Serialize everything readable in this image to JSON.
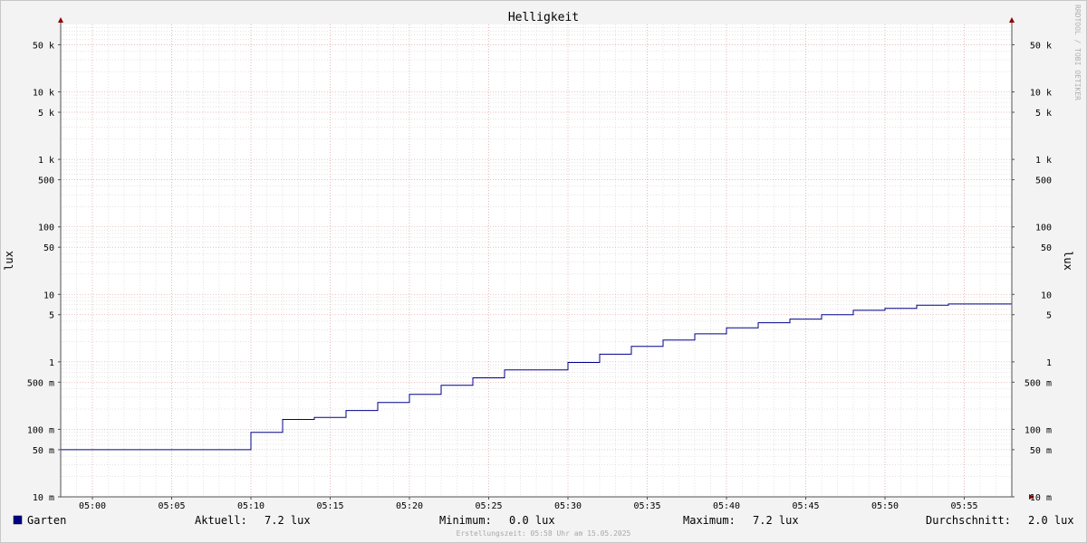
{
  "chart_data": {
    "type": "line",
    "title": "Helligkeit",
    "ylabel_left": "lux",
    "ylabel_right": "lux",
    "watermark": "RRDTOOL / TOBI OETIKER",
    "y_scale": "log",
    "ylim": [
      0.01,
      100000
    ],
    "x_start": "04:58",
    "x_end": "05:58",
    "x_ticks": [
      "05:00",
      "05:05",
      "05:10",
      "05:15",
      "05:20",
      "05:25",
      "05:30",
      "05:35",
      "05:40",
      "05:45",
      "05:50",
      "05:55"
    ],
    "y_ticks": [
      {
        "value": 0.01,
        "label": "10 m"
      },
      {
        "value": 0.05,
        "label": "50 m"
      },
      {
        "value": 0.1,
        "label": "100 m"
      },
      {
        "value": 0.5,
        "label": "500 m"
      },
      {
        "value": 1,
        "label": "1"
      },
      {
        "value": 5,
        "label": "5"
      },
      {
        "value": 10,
        "label": "10"
      },
      {
        "value": 50,
        "label": "50"
      },
      {
        "value": 100,
        "label": "100"
      },
      {
        "value": 500,
        "label": "500"
      },
      {
        "value": 1000,
        "label": "1 k"
      },
      {
        "value": 5000,
        "label": "5 k"
      },
      {
        "value": 10000,
        "label": "10 k"
      },
      {
        "value": 50000,
        "label": "50 k"
      }
    ],
    "series": [
      {
        "name": "Garten",
        "color": "#00008b",
        "step": true,
        "points": [
          {
            "x": "04:58",
            "y": 0.05
          },
          {
            "x": "05:10",
            "y": 0.09
          },
          {
            "x": "05:12",
            "y": 0.14
          },
          {
            "x": "05:14",
            "y": 0.15
          },
          {
            "x": "05:16",
            "y": 0.19
          },
          {
            "x": "05:18",
            "y": 0.25
          },
          {
            "x": "05:20",
            "y": 0.33
          },
          {
            "x": "05:22",
            "y": 0.45
          },
          {
            "x": "05:24",
            "y": 0.58
          },
          {
            "x": "05:26",
            "y": 0.76
          },
          {
            "x": "05:28",
            "y": 0.76
          },
          {
            "x": "05:30",
            "y": 0.98
          },
          {
            "x": "05:32",
            "y": 1.3
          },
          {
            "x": "05:34",
            "y": 1.7
          },
          {
            "x": "05:36",
            "y": 2.1
          },
          {
            "x": "05:38",
            "y": 2.6
          },
          {
            "x": "05:40",
            "y": 3.2
          },
          {
            "x": "05:42",
            "y": 3.8
          },
          {
            "x": "05:44",
            "y": 4.3
          },
          {
            "x": "05:46",
            "y": 5.0
          },
          {
            "x": "05:48",
            "y": 5.8
          },
          {
            "x": "05:50",
            "y": 6.2
          },
          {
            "x": "05:52",
            "y": 6.9
          },
          {
            "x": "05:54",
            "y": 7.2
          },
          {
            "x": "05:58",
            "y": 7.2
          }
        ]
      }
    ],
    "colors": {
      "grid_minor": "#c8c8c8",
      "grid_major": "#e6a0a0",
      "axis": "#505050",
      "arrow": "#8b0000",
      "background": "#f3f3f3",
      "canvas": "#ffffff"
    }
  },
  "legend": {
    "series_name": "Garten",
    "series_color": "#00008b",
    "aktuell_label": "Aktuell:",
    "aktuell_value": "7.2 lux",
    "minimum_label": "Minimum:",
    "minimum_value": "0.0 lux",
    "maximum_label": "Maximum:",
    "maximum_value": "7.2 lux",
    "durchschnitt_label": "Durchschnitt:",
    "durchschnitt_value": "2.0 lux"
  },
  "footer": {
    "creation_time": "Erstellungszeit: 05:58 Uhr am 15.05.2025"
  }
}
